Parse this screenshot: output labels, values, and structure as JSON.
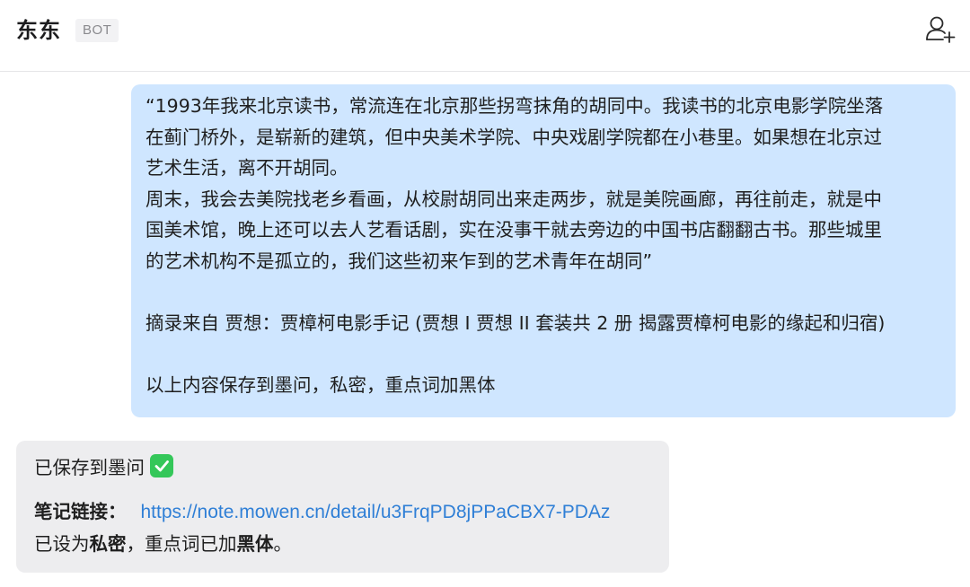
{
  "header": {
    "title": "东东",
    "badge": "BOT"
  },
  "icons": {
    "add_user": "add-user-icon",
    "check": "check-mark-icon"
  },
  "colors": {
    "user_bubble": "#cfe6ff",
    "bot_bubble": "#ededef",
    "link": "#2f7fd6",
    "check": "#34c759"
  },
  "messages": {
    "user": {
      "lines": [
        "“1993年我来北京读书，常流连在北京那些拐弯抹角的胡同中。我读书的北京电影学院坐落",
        "在蓟门桥外，是崭新的建筑，但中央美术学院、中央戏剧学院都在小巷里。如果想在北京过",
        "艺术生活，离不开胡同。",
        "周末，我会去美院找老乡看画，从校尉胡同出来走两步，就是美院画廊，再往前走，就是中",
        "国美术馆，晚上还可以去人艺看话剧，实在没事干就去旁边的中国书店翻翻古书。那些城里",
        "的艺术机构不是孤立的，我们这些初来乍到的艺术青年在胡同”"
      ],
      "source": "摘录来自 贾想：贾樟柯电影手记 (贾想 I 贾想 II 套装共 2 册 揭露贾樟柯电影的缘起和归宿)",
      "instruction": "以上内容保存到墨问，私密，重点词加黑体"
    },
    "bot": {
      "saved": "已保存到墨问",
      "link_label": "笔记链接：",
      "link_url": "https://note.mowen.cn/detail/u3FrqPD8jPPaCBX7-PDAz",
      "status_prefix": "已设为",
      "status_private": "私密",
      "status_middle": "，重点词已加",
      "status_bold": "黑体",
      "status_end": "。"
    }
  }
}
